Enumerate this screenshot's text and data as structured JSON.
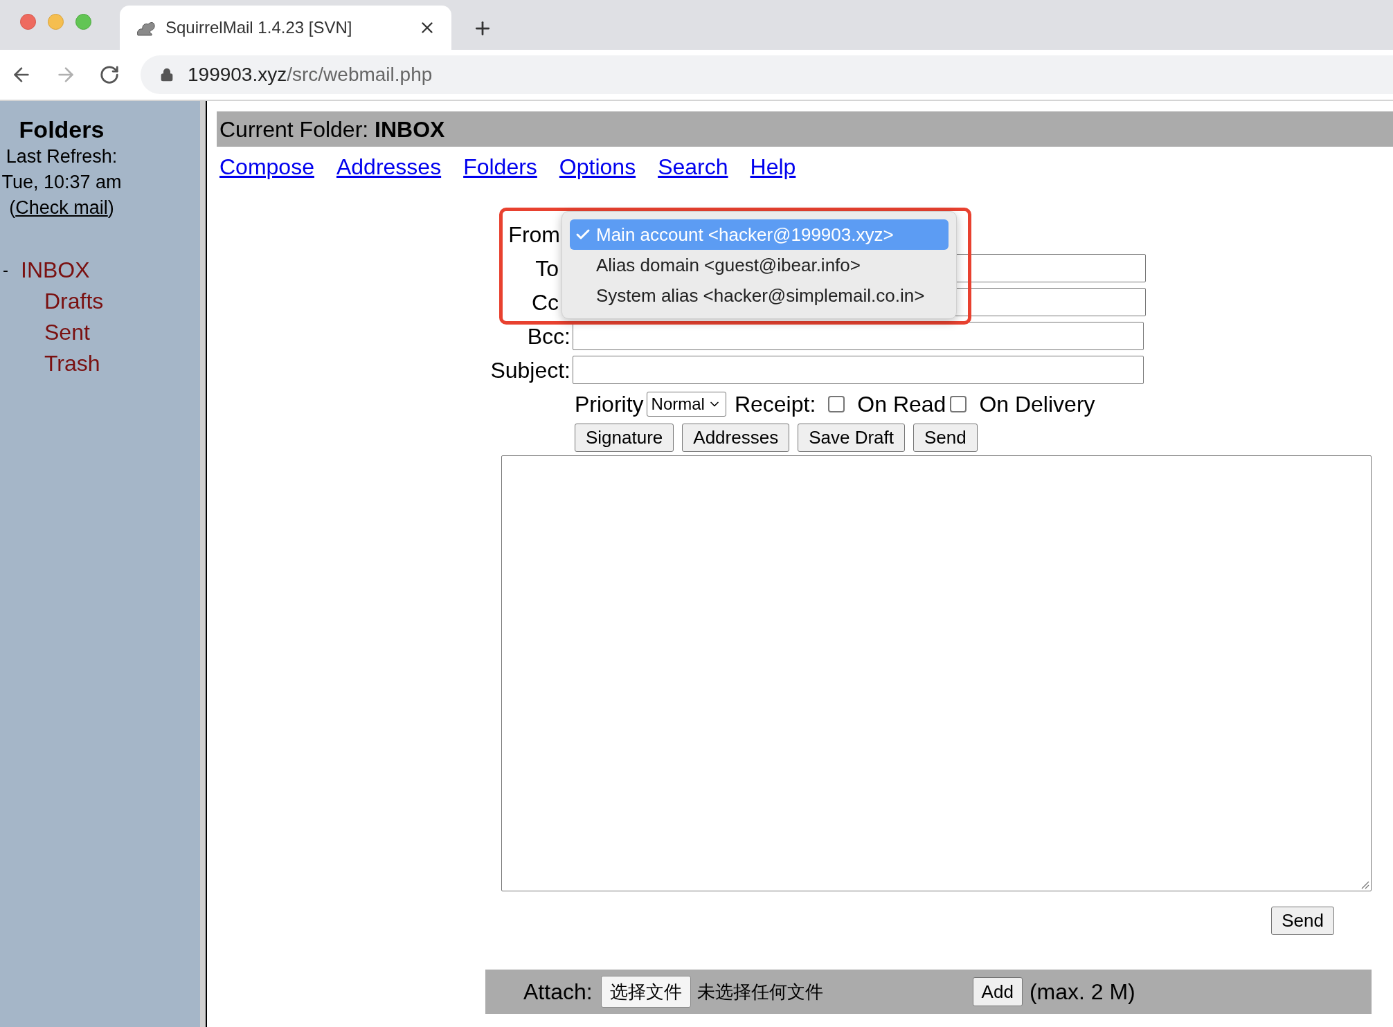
{
  "browser": {
    "tab": {
      "title": "SquirrelMail 1.4.23 [SVN]"
    },
    "nav": {
      "forward_disabled": true
    },
    "address_bar": {
      "host": "199903.xyz",
      "path": "/src/webmail.php"
    }
  },
  "sidebar": {
    "title": "Folders",
    "refresh_label": "Last Refresh:",
    "refresh_time": "Tue, 10:37 am",
    "check_mail_link": {
      "open": "(",
      "label": "Check mail",
      "close": ")"
    },
    "folders": [
      {
        "name": "INBOX",
        "toggle": "-",
        "expanded": true,
        "children": [
          {
            "name": "Drafts"
          },
          {
            "name": "Sent"
          },
          {
            "name": "Trash"
          }
        ]
      }
    ]
  },
  "header": {
    "label": "Current Folder:",
    "folder": "INBOX"
  },
  "nav_links": [
    "Compose",
    "Addresses",
    "Folders",
    "Options",
    "Search",
    "Help"
  ],
  "compose": {
    "from": {
      "label": "From",
      "options": [
        {
          "label": "Main account <hacker@199903.xyz>",
          "selected": true
        },
        {
          "label": "Alias domain <guest@ibear.info>",
          "selected": false
        },
        {
          "label": "System alias <hacker@simplemail.co.in>",
          "selected": false
        }
      ]
    },
    "fields": [
      {
        "label": "To"
      },
      {
        "label": "Cc"
      },
      {
        "label": "Bcc:"
      },
      {
        "label": "Subject:"
      }
    ],
    "priority": {
      "label": "Priority",
      "value": "Normal"
    },
    "receipt": {
      "label": "Receipt:",
      "options": [
        {
          "label": "On Read",
          "checked": false
        },
        {
          "label": "On Delivery",
          "checked": false
        }
      ]
    },
    "buttons": [
      "Signature",
      "Addresses",
      "Save Draft",
      "Send"
    ],
    "send_button": "Send"
  },
  "attach": {
    "label": "Attach:",
    "choose_button": "选择文件",
    "file_status": "未选择任何文件",
    "add_button": "Add",
    "limit": "(max. 2 M)"
  }
}
